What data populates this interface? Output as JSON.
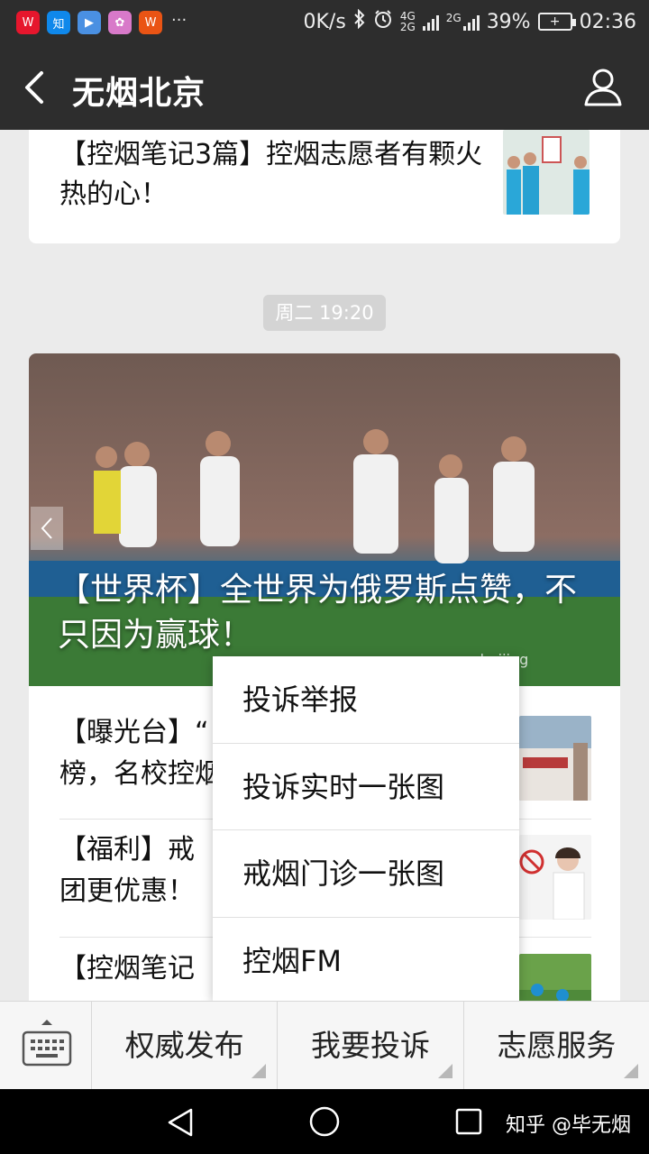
{
  "status_bar": {
    "app_icons": [
      {
        "name": "weibo-icon",
        "color": "#e6162d",
        "glyph": "W"
      },
      {
        "name": "zhihu-icon",
        "color": "#0f88eb",
        "glyph": "知"
      },
      {
        "name": "video-app-icon",
        "color": "#4a90e2",
        "glyph": "▶"
      },
      {
        "name": "photo-app-icon",
        "color": "#d879c9",
        "glyph": "✿"
      },
      {
        "name": "weibo-icon-2",
        "color": "#ea5414",
        "glyph": "W"
      }
    ],
    "more": "···",
    "net_speed": "0K/s",
    "net_type_1": "4G",
    "net_type_2": "2G",
    "sim2": "2G",
    "battery": "39%",
    "time": "02:36"
  },
  "header": {
    "title": "无烟北京"
  },
  "feed": {
    "top_card_title": "【控烟笔记3篇】控烟志愿者有颗火热的心！",
    "timestamp": "周二 19:20",
    "hero_title": "【世界杯】全世界为俄罗斯点赞，不只因为赢球！",
    "hero_watermark": "wuyanbeijing",
    "articles": [
      {
        "title": "【曝光台】“"
      },
      {
        "title": "【福利】戒"
      },
      {
        "title": "【控烟笔记"
      }
    ],
    "article_line2": [
      "榜，名校控烟",
      "团更优惠！"
    ]
  },
  "popup_menu": {
    "items": [
      "投诉举报",
      "投诉实时一张图",
      "戒烟门诊一张图",
      "控烟FM"
    ]
  },
  "bottom_menu": {
    "items": [
      "权威发布",
      "我要投诉",
      "志愿服务"
    ]
  },
  "nav": {
    "watermark": "知乎 @毕无烟"
  },
  "colors": {
    "header_bg": "#2d2d2d",
    "feed_bg": "#ebebeb"
  }
}
